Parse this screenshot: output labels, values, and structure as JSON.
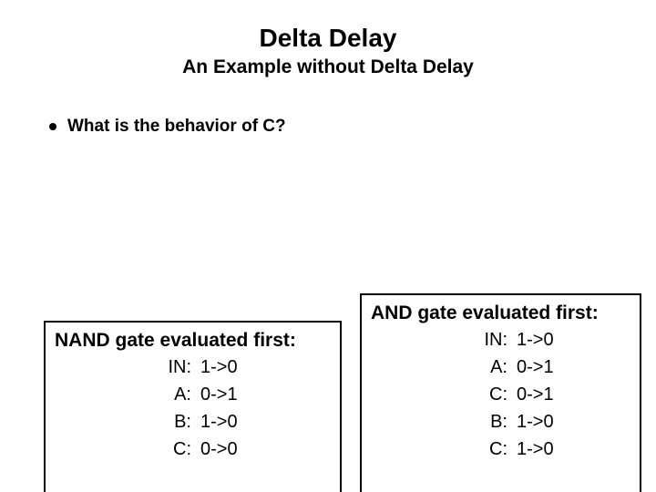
{
  "title": "Delta Delay",
  "subtitle": "An Example without Delta Delay",
  "bullet": "What is the behavior of C?",
  "left": {
    "heading": "NAND gate evaluated first:",
    "rows": [
      {
        "k": "IN:",
        "v": "1->0"
      },
      {
        "k": "A:",
        "v": "0->1"
      },
      {
        "k": "B:",
        "v": "1->0"
      },
      {
        "k": "C:",
        "v": "0->0"
      }
    ]
  },
  "right": {
    "heading": "AND gate evaluated first:",
    "rows": [
      {
        "k": "IN:",
        "v": "1->0"
      },
      {
        "k": "A:",
        "v": "0->1"
      },
      {
        "k": "C:",
        "v": "0->1"
      },
      {
        "k": "B:",
        "v": "1->0"
      },
      {
        "k": "C:",
        "v": "1->0"
      }
    ]
  }
}
